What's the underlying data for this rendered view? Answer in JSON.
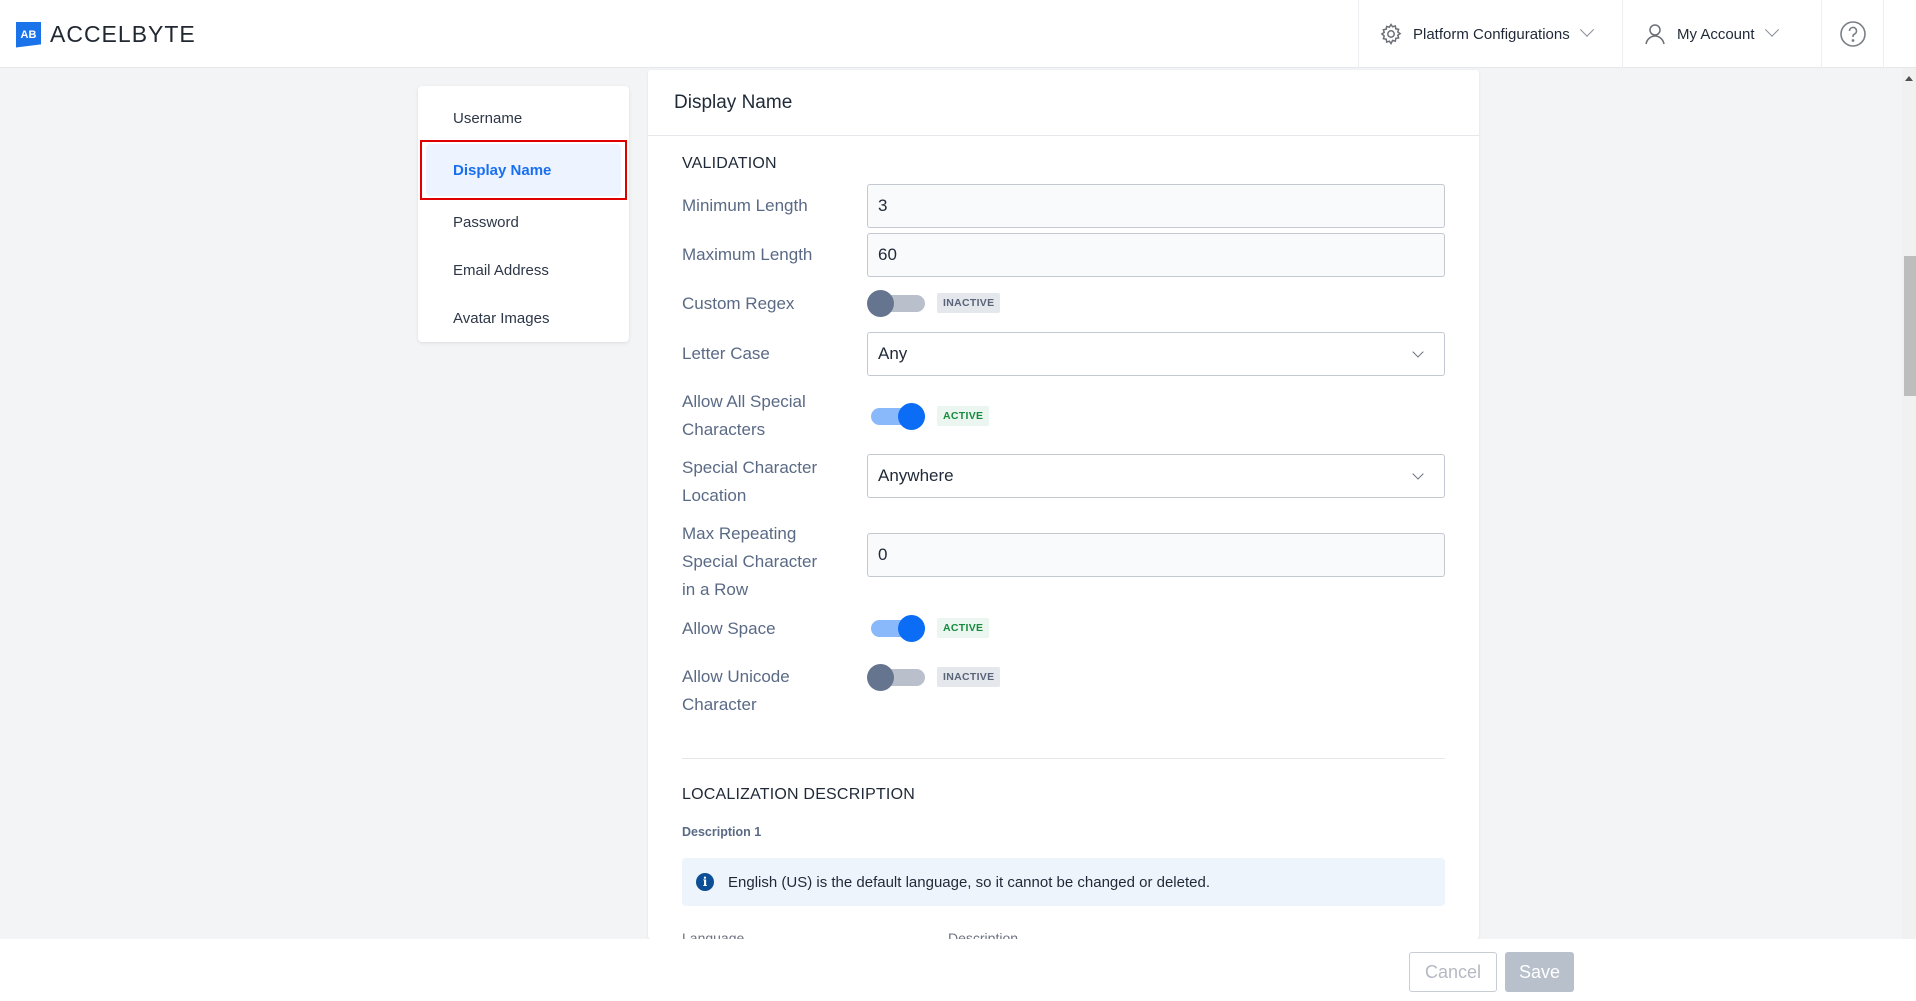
{
  "header": {
    "logo_text": "ACCELBYTE",
    "logo_mark": "AB",
    "nav": {
      "platform_configurations": "Platform Configurations",
      "my_account": "My Account",
      "help_icon": "question-circle-icon"
    }
  },
  "sidebar": {
    "items": [
      {
        "label": "Username",
        "active": false
      },
      {
        "label": "Display Name",
        "active": true
      },
      {
        "label": "Password",
        "active": false
      },
      {
        "label": "Email Address",
        "active": false
      },
      {
        "label": "Avatar Images",
        "active": false
      }
    ]
  },
  "main": {
    "title": "Display Name",
    "validation": {
      "section_title": "VALIDATION",
      "minimum_length": {
        "label": "Minimum Length",
        "value": "3"
      },
      "maximum_length": {
        "label": "Maximum Length",
        "value": "60"
      },
      "custom_regex": {
        "label": "Custom Regex",
        "state": "INACTIVE"
      },
      "letter_case": {
        "label": "Letter Case",
        "value": "Any"
      },
      "allow_all_special": {
        "label": "Allow All Special Characters",
        "label_line1": "Allow All Special",
        "label_line2": "Characters",
        "state": "ACTIVE"
      },
      "special_char_location": {
        "label_line1": "Special Character",
        "label_line2": "Location",
        "value": "Anywhere"
      },
      "max_repeating": {
        "label_line1": "Max Repeating",
        "label_line2": "Special Character",
        "label_line3": "in a Row",
        "value": "0"
      },
      "allow_space": {
        "label": "Allow Space",
        "state": "ACTIVE"
      },
      "allow_unicode": {
        "label_line1": "Allow Unicode",
        "label_line2": "Character",
        "state": "INACTIVE"
      }
    },
    "localization": {
      "section_title": "LOCALIZATION DESCRIPTION",
      "description_label": "Description 1",
      "info_text": "English (US) is the default language, so it cannot be changed or deleted.",
      "col_language": "Language",
      "col_description": "Description"
    }
  },
  "footer": {
    "cancel_label": "Cancel",
    "save_label": "Save"
  },
  "colors": {
    "brand": "#1a73e8",
    "active_nav": "#1a6ff0",
    "toggle_on": "#0b6cf5",
    "badge_active": "#188a3e",
    "highlight_border": "#e00000"
  }
}
